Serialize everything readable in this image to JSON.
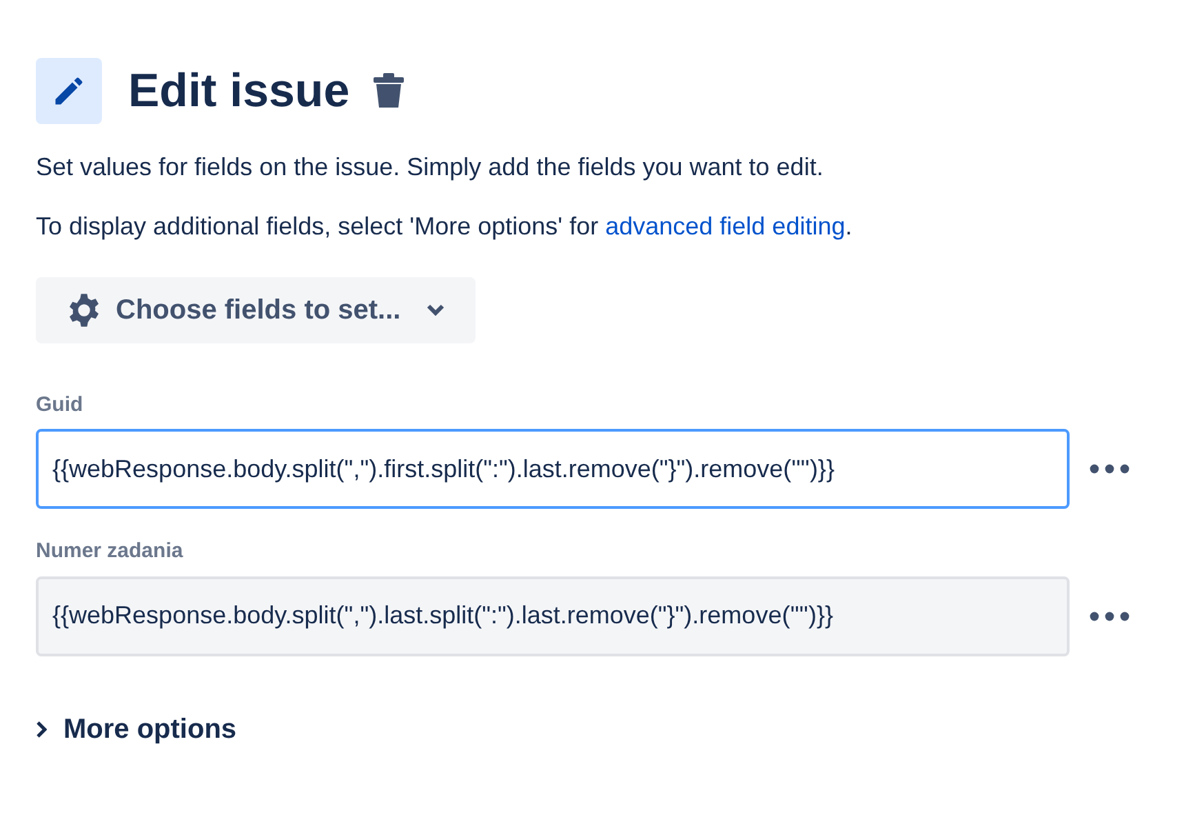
{
  "header": {
    "title": "Edit issue"
  },
  "description": "Set values for fields on the issue. Simply add the fields you want to edit.",
  "hint": {
    "text": "To display additional fields, select 'More options' for ",
    "link": "advanced field editing",
    "end": "."
  },
  "choose_button": {
    "label": "Choose fields to set..."
  },
  "fields": [
    {
      "label": "Guid",
      "value": "{{webResponse.body.split(\",\").first.split(\":\").last.remove(\"}\").remove('\"')}}",
      "focused": true
    },
    {
      "label": "Numer zadania",
      "value": "{{webResponse.body.split(\",\").last.split(\":\").last.remove(\"}\").remove('\"')}}",
      "focused": false
    }
  ],
  "more_options": {
    "label": "More options",
    "expanded": false
  }
}
